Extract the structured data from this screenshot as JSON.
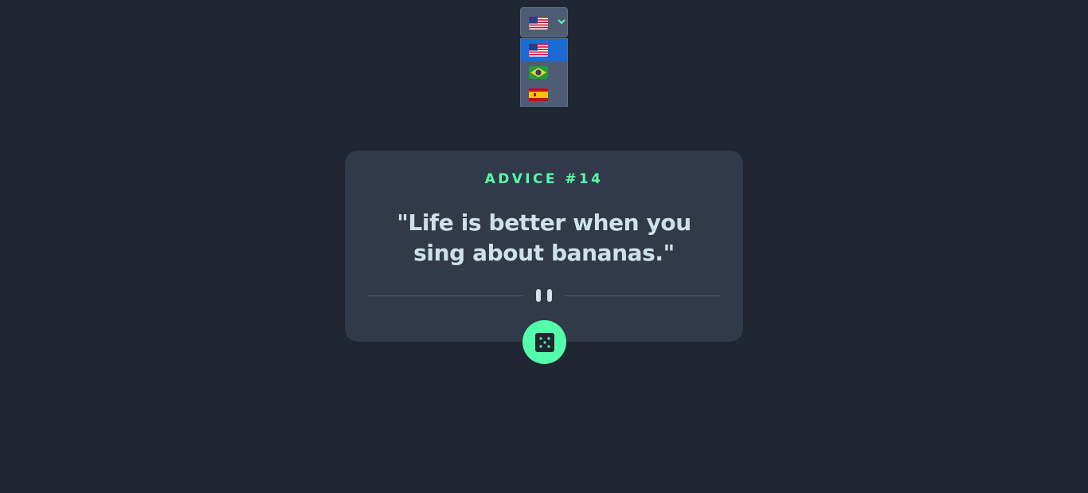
{
  "language_selector": {
    "current": "en-US",
    "current_flag_icon": "us-flag-icon",
    "chevron_icon": "chevron-down-icon",
    "options": [
      {
        "code": "en-US",
        "icon": "us-flag-icon",
        "selected": true
      },
      {
        "code": "pt-BR",
        "icon": "brazil-flag-icon",
        "selected": false
      },
      {
        "code": "es-ES",
        "icon": "spain-flag-icon",
        "selected": false
      }
    ]
  },
  "advice": {
    "id_label": "ADVICE #14",
    "text": "\"Life is better when you sing about bananas.\""
  },
  "divider": {
    "icon": "pause-icon"
  },
  "dice_button": {
    "icon": "dice-icon"
  },
  "colors": {
    "background": "#202632",
    "card": "#313a48",
    "accent": "#53ffab",
    "text": "#cee3e9",
    "selector_bg": "#4e5d73",
    "option_selected": "#1a6bd6"
  }
}
